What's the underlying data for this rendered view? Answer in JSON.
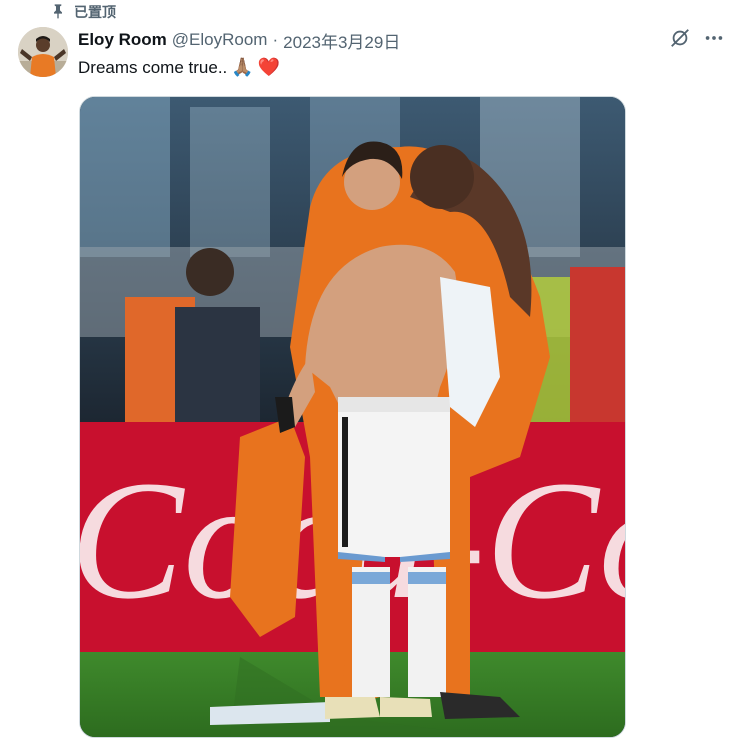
{
  "pinned": {
    "label": "已置顶",
    "icon": "pin-icon"
  },
  "tweet": {
    "author_name": "Eloy Room",
    "handle": "@EloyRoom",
    "separator": "·",
    "date": "2023年3月29日",
    "text": "Dreams come true..",
    "emojis": [
      "🙏🏽",
      "❤️"
    ]
  },
  "actions": {
    "grok_icon": "grok-icon",
    "more_icon": "more-icon"
  },
  "media": {
    "banner_text": "Coca-Cola"
  },
  "colors": {
    "secondary_text": "#536471",
    "primary_text": "#0f1419",
    "heart": "#e0142d"
  }
}
